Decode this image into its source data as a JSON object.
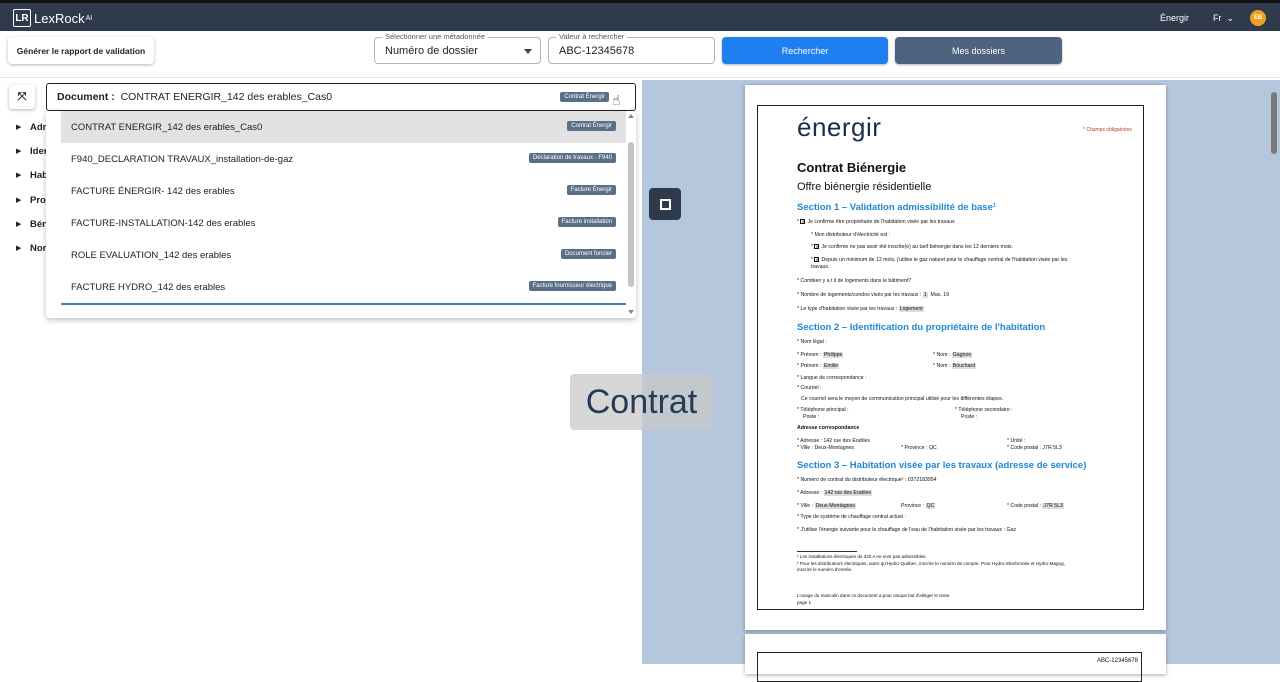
{
  "app": {
    "logo_text": "LexRock",
    "logo_sup": "AI",
    "logo_icon_text": "LR",
    "brand": "Énergir",
    "lang": "Fr",
    "avatar_initials": "EB"
  },
  "toolbar": {
    "report_label": "Générer le rapport de validation",
    "metadata_label": "Sélectionner une métadonnée",
    "metadata_value": "Numéro de dossier",
    "search_value_label": "Valeur à rechercher",
    "search_value": "ABC-12345678",
    "search_button": "Rechercher",
    "dossiers_button": "Mes dossiers"
  },
  "tree": {
    "nodes": [
      "Adm",
      "Ider",
      "Hab",
      "Proj",
      "Bén",
      "Nor"
    ]
  },
  "document": {
    "prefix": "Document :",
    "selected": "CONTRAT ENERGIR_142 des erables_Cas0",
    "selected_tag": "Contrat Énergir",
    "options": [
      {
        "name": "CONTRAT ENERGIR_142 des erables_Cas0",
        "tag": "Contrat Énergir"
      },
      {
        "name": "F940_DECLARATION TRAVAUX_installation-de-gaz",
        "tag": "Déclaration de travaux - F940"
      },
      {
        "name": "FACTURE ÉNERGIR- 142 des erables",
        "tag": "Facture Énergir"
      },
      {
        "name": "FACTURE-INSTALLATION-142 des erables",
        "tag": "Facture installation"
      },
      {
        "name": "ROLE EVALUATION_142 des erables",
        "tag": "Document foncier"
      },
      {
        "name": "FACTURE HYDRO_142 des erables",
        "tag": "Facture fournisseur électrique"
      }
    ]
  },
  "overlay_label": "Contrat",
  "page": {
    "logo": "énergir",
    "required": "* Champs obligatoires",
    "title": "Contrat Biénergie",
    "subtitle": "Offre biénergie résidentielle",
    "sec1": "Section 1 – Validation admissibilité de base¹",
    "s1_l1": "Je confirme être propriétaire de l'habitation visée par les travaux",
    "s1_l2": "* Mon distributeur d'électricité est :",
    "s1_l3": "Je confirme ne pas avoir été inscrite(e) au tarif biénergie dans les 12 derniers mois.",
    "s1_l4": "Depuis un minimum de 12 mois, j'utilise le gaz naturel pour le chauffage central de l'habitation visée par les",
    "s1_l4b": "travaux.",
    "s1_l5": "* Combien y a t il de logements dans le bâtiment?",
    "s1_l6": "* Nombre de logements/condos visés par les travaux :",
    "s1_l6_val": "1",
    "s1_l6_max": "Max. 19",
    "s1_l7": "* Le type d'habitation visée par les travaux :",
    "s1_l7_val": "Logement",
    "sec2": "Section 2 – Identification du propriétaire de l'habitation",
    "s2_nom_legal": "* Nom légal :",
    "s2_prenom": "* Prénom :",
    "s2_prenom1": "Philippe",
    "s2_prenom2": "Emilie",
    "s2_nom": "* Nom :",
    "s2_nom1": "Gagnon",
    "s2_nom2": "Bouchard",
    "s2_langue": "* Langue de correspondance :",
    "s2_courriel": "* Courriel :",
    "s2_courriel_note": "Ce courriel sera le moyen de communication principal utilisé pour les différentes étapes.",
    "s2_tel": "* Téléphone principal :",
    "s2_tel2": "* Téléphone secondaire :",
    "s2_poste": "Poste :",
    "s2_adresse_corr": "Adresse correspondance",
    "s2_adresse": "* Adresse : 142 rue des Erables",
    "s2_unite": "* Unité :",
    "s2_ville": "* Ville : Deux-Montagnes",
    "s2_province": "* Province : QC",
    "s2_cp": "* Code postal : J7R 5L3",
    "sec3": "Section 3 – Habitation visée par les travaux (adresse de service)",
    "s3_contrat": "* Numéro de contrat du distributeur électrique² : 0372183954",
    "s3_adresse": "* Adresse :",
    "s3_adresse_val": "142 rue des Erables",
    "s3_ville": "* Ville :",
    "s3_ville_val": "Deux-Montagnes",
    "s3_province": "Province :",
    "s3_province_val": "QC",
    "s3_cp": "* Code postal :",
    "s3_cp_val": "J7R 5L3",
    "s3_chauffage": "* Type de système de chauffage central actuel :",
    "s3_energie": "* J'utilise l'énergie suivante pour le chauffage de l'eau de l'habitation visée par les travaux :",
    "s3_energie_val": "Gaz",
    "fn1": "¹ Les installations électriques de 320 A ne sont pas admissibles.",
    "fn2": "² Pour les distributeurs électriques, autre qu'Hydro-Québec, inscrire le numéro de compte. Pour Hydro-Sherbrooke et Hydro-Magog,",
    "fn2b": "inscrire le numéro d'entrée.",
    "note": "L'usage du masculin dans ce document a pour unique but d'alléger le texte.",
    "page_no": "page 1",
    "page2_ref": "ABC-12345678"
  }
}
